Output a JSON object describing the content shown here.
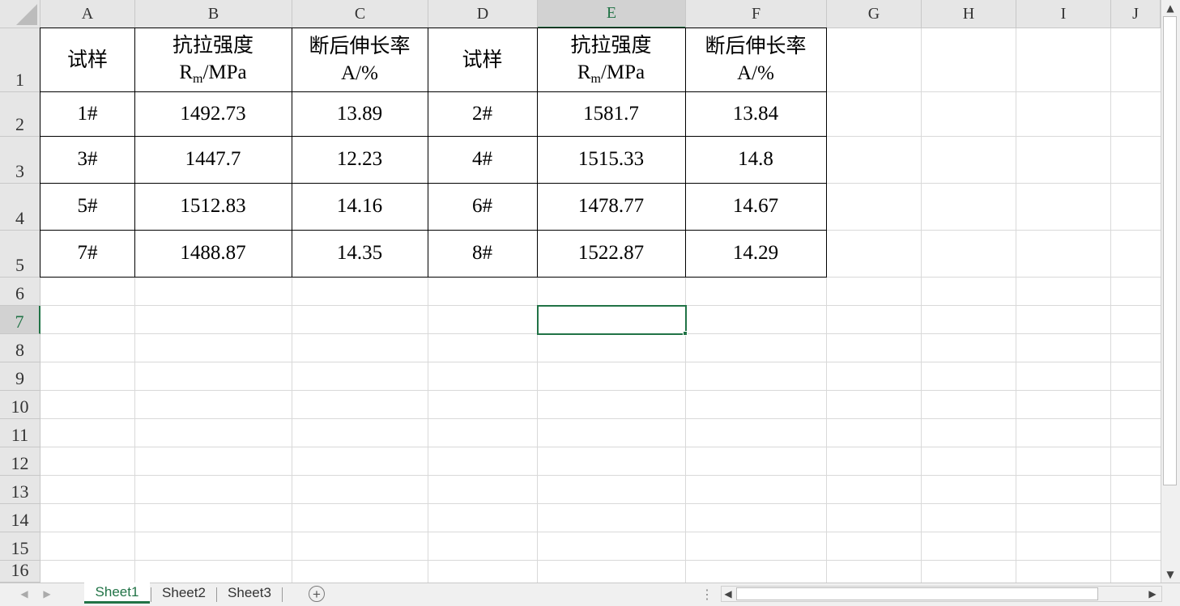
{
  "columns": [
    "A",
    "B",
    "C",
    "D",
    "E",
    "F",
    "G",
    "H",
    "I",
    "J"
  ],
  "rows": [
    "1",
    "2",
    "3",
    "4",
    "5",
    "6",
    "7",
    "8",
    "9",
    "10",
    "11",
    "12",
    "13",
    "14",
    "15",
    "16"
  ],
  "selected": {
    "column": "E",
    "row": "7"
  },
  "table": {
    "header": {
      "sample": "试样",
      "tensile_cn": "抗拉强度",
      "tensile_r": "R",
      "tensile_sub": "m",
      "tensile_unit": "/MPa",
      "elong_cn": "断后伸长率",
      "elong_unit": "A/%"
    },
    "data": [
      [
        "1#",
        "1492.73",
        "13.89",
        "2#",
        "1581.7",
        "13.84"
      ],
      [
        "3#",
        "1447.7",
        "12.23",
        "4#",
        "1515.33",
        "14.8"
      ],
      [
        "5#",
        "1512.83",
        "14.16",
        "6#",
        "1478.77",
        "14.67"
      ],
      [
        "7#",
        "1488.87",
        "14.35",
        "8#",
        "1522.87",
        "14.29"
      ]
    ]
  },
  "sheets": [
    "Sheet1",
    "Sheet2",
    "Sheet3"
  ],
  "active_sheet": "Sheet1",
  "icons": {
    "add_sheet": "plus-circle-icon",
    "scroll_up": "triangle-up-icon",
    "scroll_down": "triangle-down-icon",
    "scroll_left": "triangle-left-icon",
    "scroll_right": "triangle-right-icon",
    "options": "vertical-dots-icon"
  },
  "colors": {
    "accent": "#217346",
    "header_bg": "#e6e6e6",
    "grid": "#d9d9d9"
  }
}
